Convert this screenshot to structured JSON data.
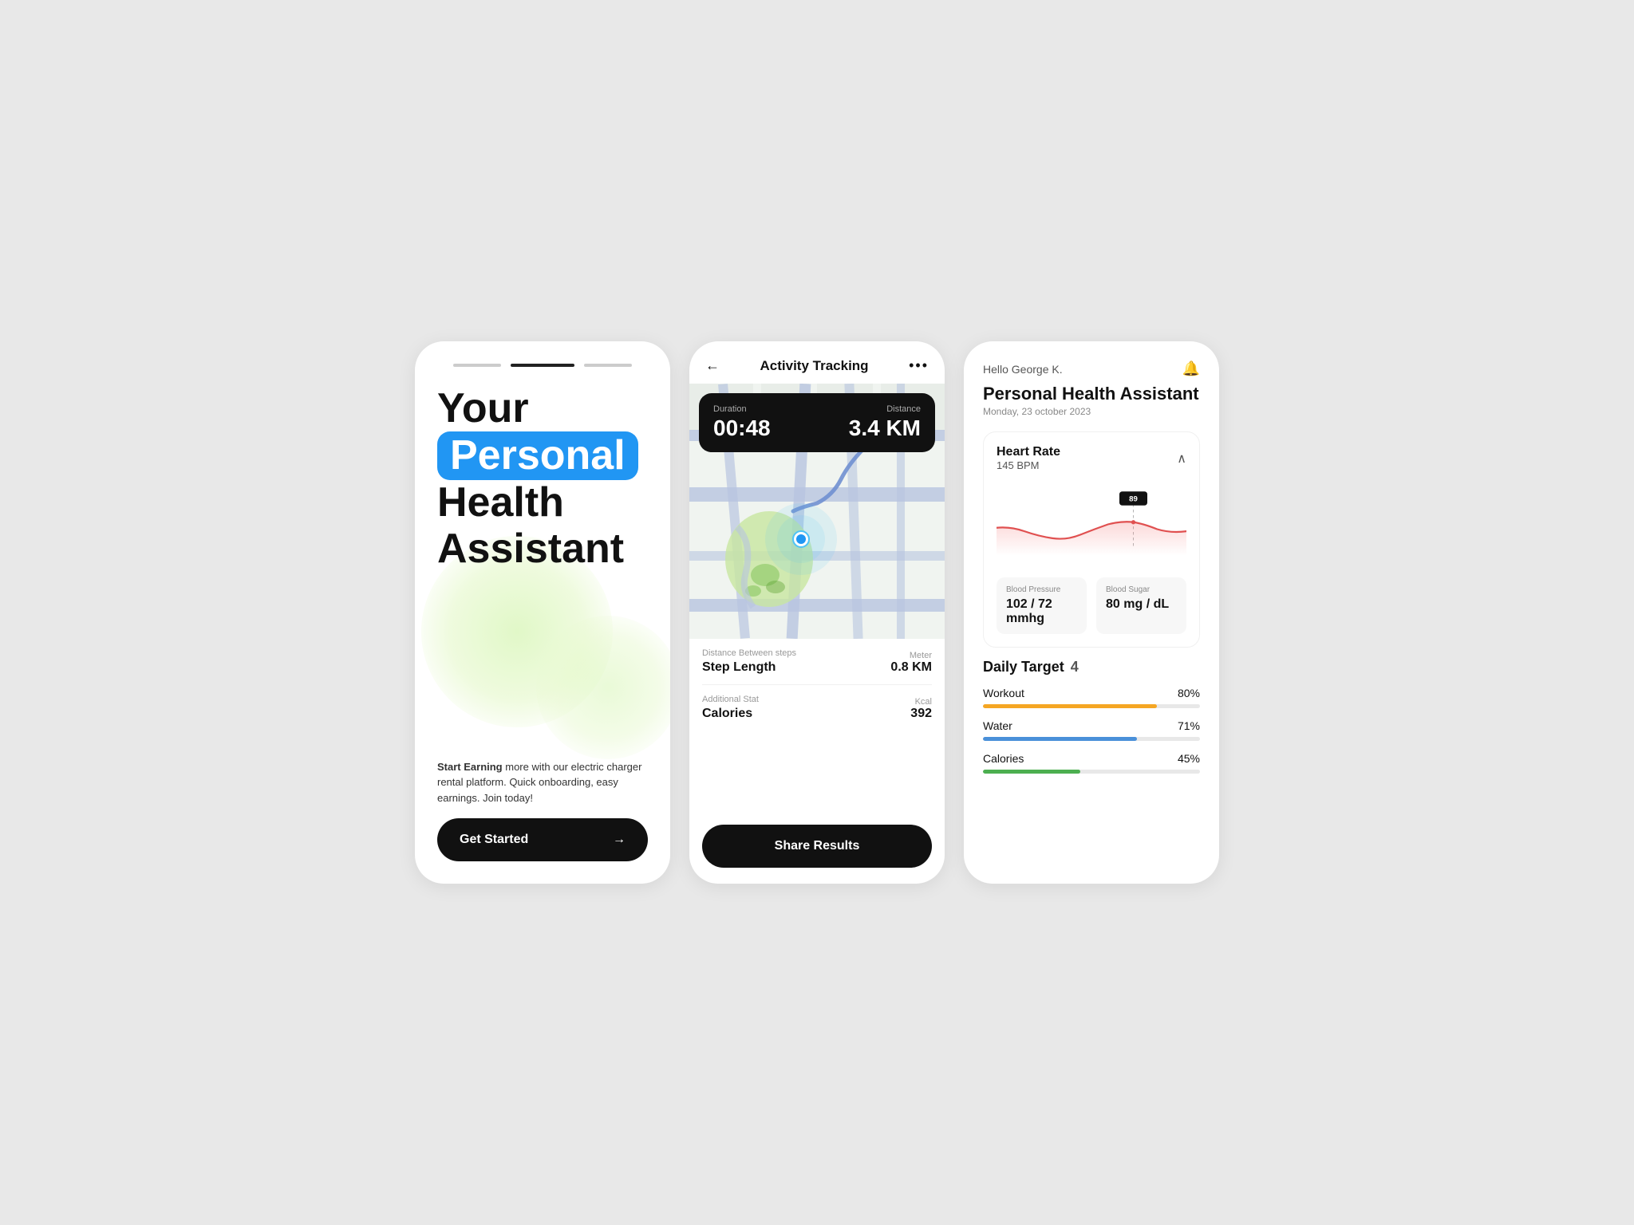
{
  "screen1": {
    "topbars": [
      "inactive",
      "active",
      "inactive"
    ],
    "hero_line1": "Your",
    "hero_highlight": "Personal",
    "hero_line2": "Health",
    "hero_line3": "Assistant",
    "tagline_bold": "Start Earning",
    "tagline_rest": " more with our electric charger rental platform. Quick onboarding, easy earnings. Join today!",
    "cta_label": "Get Started",
    "cta_arrow": "→"
  },
  "screen2": {
    "header_title": "Activity Tracking",
    "back_icon": "←",
    "more_icon": "•••",
    "duration_label": "Duration",
    "duration_value": "00:48",
    "distance_label": "Distance",
    "distance_value": "3.4 KM",
    "stats": [
      {
        "category": "Distance Between steps",
        "label": "Step Length",
        "unit": "Meter",
        "value": "0.8 KM"
      },
      {
        "category": "Additional Stat",
        "label": "Calories",
        "unit": "Kcal",
        "value": "392"
      }
    ],
    "share_button": "Share Results"
  },
  "screen3": {
    "greeting": "Hello George K.",
    "bell_icon": "🔔",
    "title": "Personal Health Assistant",
    "date": "Monday, 23 october 2023",
    "heart_rate": {
      "title": "Heart Rate",
      "value": "145",
      "unit": "BPM",
      "tooltip": "89"
    },
    "vitals": [
      {
        "label": "Blood Pressure",
        "value": "102 / 72 mmhg"
      },
      {
        "label": "Blood Sugar",
        "value": "80 mg / dL"
      }
    ],
    "daily_target": {
      "title": "Daily Target",
      "count": "4",
      "items": [
        {
          "label": "Workout",
          "pct": 80,
          "pct_label": "80%",
          "color": "#F5A623"
        },
        {
          "label": "Water",
          "pct": 71,
          "pct_label": "71%",
          "color": "#4A90D9"
        },
        {
          "label": "Calories",
          "pct": 45,
          "pct_label": "45%",
          "color": "#4CAF50"
        }
      ]
    }
  }
}
